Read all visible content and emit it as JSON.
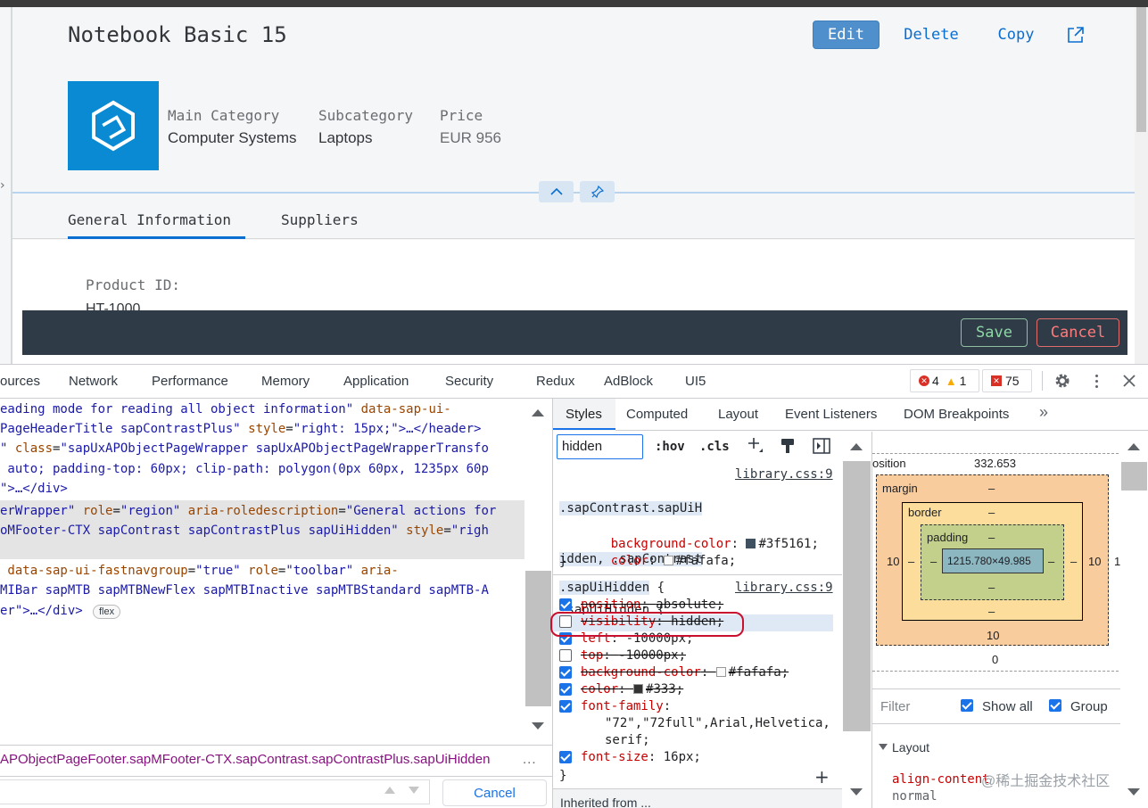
{
  "app": {
    "title": "Notebook Basic 15",
    "actions": {
      "edit": "Edit",
      "delete": "Delete",
      "copy": "Copy"
    },
    "header_fields": [
      {
        "label": "Main Category",
        "value": "Computer Systems"
      },
      {
        "label": "Subcategory",
        "value": "Laptops"
      },
      {
        "label": "Price",
        "value": "EUR 956"
      }
    ],
    "tabs": [
      "General Information",
      "Suppliers"
    ],
    "section_label": "Product ID:",
    "section_value": "HT-1000",
    "footer": {
      "save": "Save",
      "cancel": "Cancel"
    },
    "brand_color": "#0a8ad2",
    "footer_color": "#2f3c48"
  },
  "devtools": {
    "tabs": [
      "ources",
      "Network",
      "Performance",
      "Memory",
      "Application",
      "Security",
      "Redux",
      "AdBlock",
      "UI5"
    ],
    "badges": {
      "errors": "4",
      "warnings": "1",
      "issues": "75"
    },
    "elements_lines": [
      [
        {
          "t": "eading mode for reading all object information\"",
          "c": "av"
        },
        {
          "t": " data-sap-ui-",
          "c": "at"
        }
      ],
      [
        {
          "t": "PageHeaderTitle sapContrastPlus\"",
          "c": "av"
        },
        {
          "t": " style",
          "c": "at"
        },
        {
          "t": "=",
          "c": "tx"
        },
        {
          "t": "\"right: 15px;\"",
          "c": "av"
        },
        {
          "t": ">…</header>",
          "c": "av"
        }
      ],
      [
        {
          "t": "\"",
          "c": "av"
        },
        {
          "t": " class",
          "c": "at"
        },
        {
          "t": "=",
          "c": "tx"
        },
        {
          "t": "\"sapUxAPObjectPageWrapper sapUxAPObjectPageWrapperTransfo",
          "c": "av"
        }
      ],
      [
        {
          "t": " auto; padding-top: 60px; clip-path: polygon(0px 60px, 1235px 60p",
          "c": "av"
        }
      ],
      [
        {
          "t": "\">…</div>",
          "c": "av"
        }
      ],
      [
        {
          "t": "erWrapper\"",
          "c": "av"
        },
        {
          "t": " role",
          "c": "at"
        },
        {
          "t": "=",
          "c": "tx"
        },
        {
          "t": "\"region\"",
          "c": "av"
        },
        {
          "t": " aria-roledescription",
          "c": "at"
        },
        {
          "t": "=",
          "c": "tx"
        },
        {
          "t": "\"General actions for",
          "c": "av"
        }
      ],
      [
        {
          "t": "oMFooter-CTX sapContrast sapContrastPlus sapUiHidden\"",
          "c": "av"
        },
        {
          "t": " style",
          "c": "at"
        },
        {
          "t": "=",
          "c": "tx"
        },
        {
          "t": "\"righ",
          "c": "av"
        }
      ],
      [
        {
          "t": "",
          "c": "tx"
        }
      ],
      [
        {
          "t": " data-sap-ui-fastnavgroup",
          "c": "at"
        },
        {
          "t": "=",
          "c": "tx"
        },
        {
          "t": "\"true\"",
          "c": "av"
        },
        {
          "t": " role",
          "c": "at"
        },
        {
          "t": "=",
          "c": "tx"
        },
        {
          "t": "\"toolbar\"",
          "c": "av"
        },
        {
          "t": " aria-",
          "c": "at"
        }
      ],
      [
        {
          "t": "MIBar sapMTB sapMTBNewFlex sapMTBInactive sapMTBStandard sapMTB-A",
          "c": "av"
        }
      ],
      [
        {
          "t": "er\">…</div>",
          "c": "av"
        }
      ]
    ],
    "flex_badge": "flex",
    "breadcrumb": "APObjectPageFooter.sapMFooter-CTX.sapContrast.sapContrastPlus.sapUiHidden",
    "ellipsis": "...",
    "search_cancel": "Cancel",
    "styles_tabs": [
      "Styles",
      "Computed",
      "Layout",
      "Event Listeners",
      "DOM Breakpoints"
    ],
    "filter_value": "hidden",
    "hov": ":hov",
    "cls": ".cls",
    "rule1": {
      "selector": [
        ".sapContrast.sapUiH",
        "idden, .sapContrast",
        ".sapUiHidden {"
      ],
      "source": "library.css:9",
      "decls": [
        {
          "prop": "background-color",
          "value": "#3f5161;",
          "swatch": "#3f5161"
        },
        {
          "prop": "color",
          "value": "#fafafa;",
          "swatch": "#fafafa"
        }
      ],
      "close": "}"
    },
    "rule2": {
      "selector": ".sapUiHidden",
      "brace": " {",
      "source": "library.css:9",
      "decls": [
        {
          "prop": "position",
          "value": "absolute;",
          "checked": true,
          "strike": true
        },
        {
          "prop": "visibility",
          "value": "hidden;",
          "checked": false,
          "strike": true
        },
        {
          "prop": "left",
          "value": "-10000px;",
          "checked": true,
          "strike": false
        },
        {
          "prop": "top",
          "value": "-10000px;",
          "checked": false,
          "strike": true
        },
        {
          "prop": "background-color",
          "value": "#fafafa;",
          "checked": true,
          "strike": true,
          "swatch": "#fafafa"
        },
        {
          "prop": "color",
          "value": "#333;",
          "checked": true,
          "strike": true,
          "swatch": "#333333"
        },
        {
          "prop": "font-family",
          "value": "",
          "checked": true,
          "strike": false
        },
        {
          "prop": "",
          "value": "\"72\",\"72full\",Arial,Helvetica,",
          "checked": null,
          "strike": false
        },
        {
          "prop": "",
          "value": "serif;",
          "checked": null,
          "strike": false
        },
        {
          "prop": "font-size",
          "value": "16px;",
          "checked": true,
          "strike": false
        }
      ],
      "close": "}"
    },
    "inherited": "Inherited from ...",
    "boxmodel": {
      "position_label": "osition",
      "position_value": "332.653",
      "margin_label": "margin",
      "border_label": "border",
      "padding_label": "padding",
      "dash": "–",
      "content": "1215.780×49.985",
      "left_margin": "10",
      "right_margin": "10",
      "bottom_margin": "10",
      "right_edge": "1",
      "position_bottom": "0"
    },
    "computed": {
      "filter_placeholder": "Filter",
      "show_all": "Show all",
      "group": "Group",
      "layout_heading": "Layout",
      "prop": "align-content",
      "value": "normal"
    },
    "watermark": "@稀土掘金技术社区"
  }
}
